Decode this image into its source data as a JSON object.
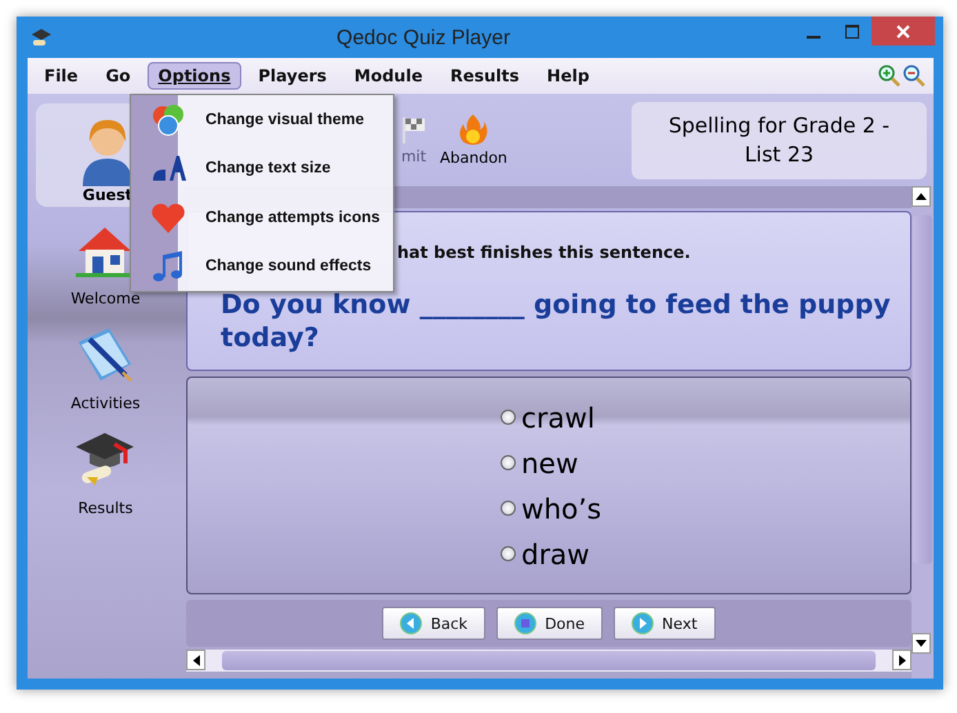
{
  "window": {
    "title": "Qedoc Quiz Player"
  },
  "menu_bar": [
    {
      "label": "File",
      "selected": false
    },
    {
      "label": "Go",
      "selected": false
    },
    {
      "label": "Options",
      "selected": true
    },
    {
      "label": "Players",
      "selected": false
    },
    {
      "label": "Module",
      "selected": false
    },
    {
      "label": "Results",
      "selected": false
    },
    {
      "label": "Help",
      "selected": false
    }
  ],
  "options_menu": [
    {
      "label": "Change visual theme",
      "kind": "theme"
    },
    {
      "label": "Change text size",
      "kind": "text"
    },
    {
      "label": "Change attempts icons",
      "kind": "heart"
    },
    {
      "label": "Change sound effects",
      "kind": "sound"
    }
  ],
  "player": {
    "name": "Guest"
  },
  "sidebar": {
    "items": [
      {
        "label": "Welcome",
        "kind": "house"
      },
      {
        "label": "Activities",
        "kind": "book"
      },
      {
        "label": "Results",
        "kind": "cap"
      }
    ]
  },
  "toolbar": [
    {
      "label": "mit",
      "kind": "flag"
    },
    {
      "label": "Abandon",
      "kind": "fire"
    }
  ],
  "module_title": "Spelling for Grade 2 - List 23",
  "question": {
    "instruction": "hat best finishes this sentence.",
    "text": "Do you know ________ going to feed the puppy today?"
  },
  "answers": [
    {
      "label": "crawl",
      "selected": false
    },
    {
      "label": "new",
      "selected": false
    },
    {
      "label": "who’s",
      "selected": false
    },
    {
      "label": "draw",
      "selected": false
    }
  ],
  "buttons": [
    {
      "label": "Back",
      "kind": "back"
    },
    {
      "label": "Done",
      "kind": "done"
    },
    {
      "label": "Next",
      "kind": "next"
    }
  ]
}
